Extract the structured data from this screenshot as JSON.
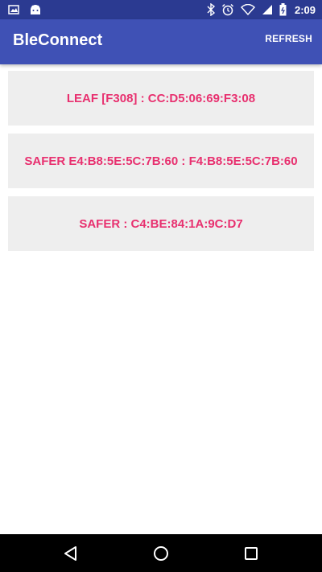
{
  "status_bar": {
    "time": "2:09",
    "left_icons": [
      "image-icon",
      "android-icon"
    ],
    "right_icons": [
      "bluetooth-icon",
      "alarm-icon",
      "wifi-icon",
      "signal-icon",
      "battery-icon"
    ]
  },
  "app_bar": {
    "title": "BleConnect",
    "refresh_label": "REFRESH",
    "color": "#3f51b5"
  },
  "devices": [
    {
      "label": "LEAF [F308] : CC:D5:06:69:F3:08"
    },
    {
      "label": "SAFER E4:B8:5E:5C:7B:60 : F4:B8:5E:5C:7B:60"
    },
    {
      "label": "SAFER : C4:BE:84:1A:9C:D7"
    }
  ],
  "colors": {
    "accent_text": "#e8306f",
    "item_background": "#eeeeee",
    "status_bar": "#2b3a91"
  },
  "nav_bar": {
    "buttons": [
      "back-icon",
      "home-icon",
      "recent-apps-icon"
    ]
  }
}
